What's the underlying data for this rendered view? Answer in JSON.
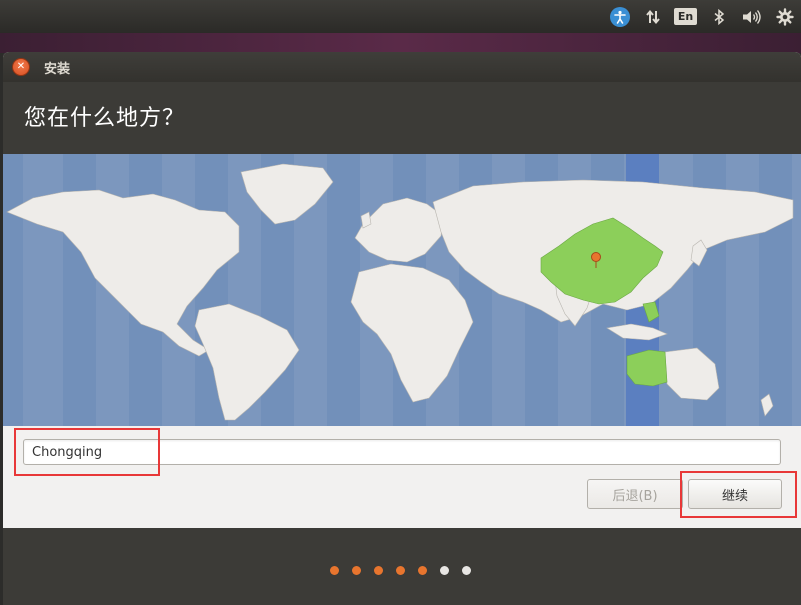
{
  "panel": {
    "keyboard_indicator": "En"
  },
  "window": {
    "title": "安装",
    "page_title": "您在什么地方？"
  },
  "location": {
    "timezone_value": "Chongqing",
    "selected_region": "China",
    "highlight_color": "#8ccf5a"
  },
  "buttons": {
    "back_label": "后退(B)",
    "continue_label": "继续"
  },
  "progress": {
    "total_steps": 7,
    "completed_steps": 5
  },
  "colors": {
    "ocean": "#7c97be",
    "land": "#eeece9",
    "accent": "#e8752e",
    "annotation": "#e83838"
  }
}
